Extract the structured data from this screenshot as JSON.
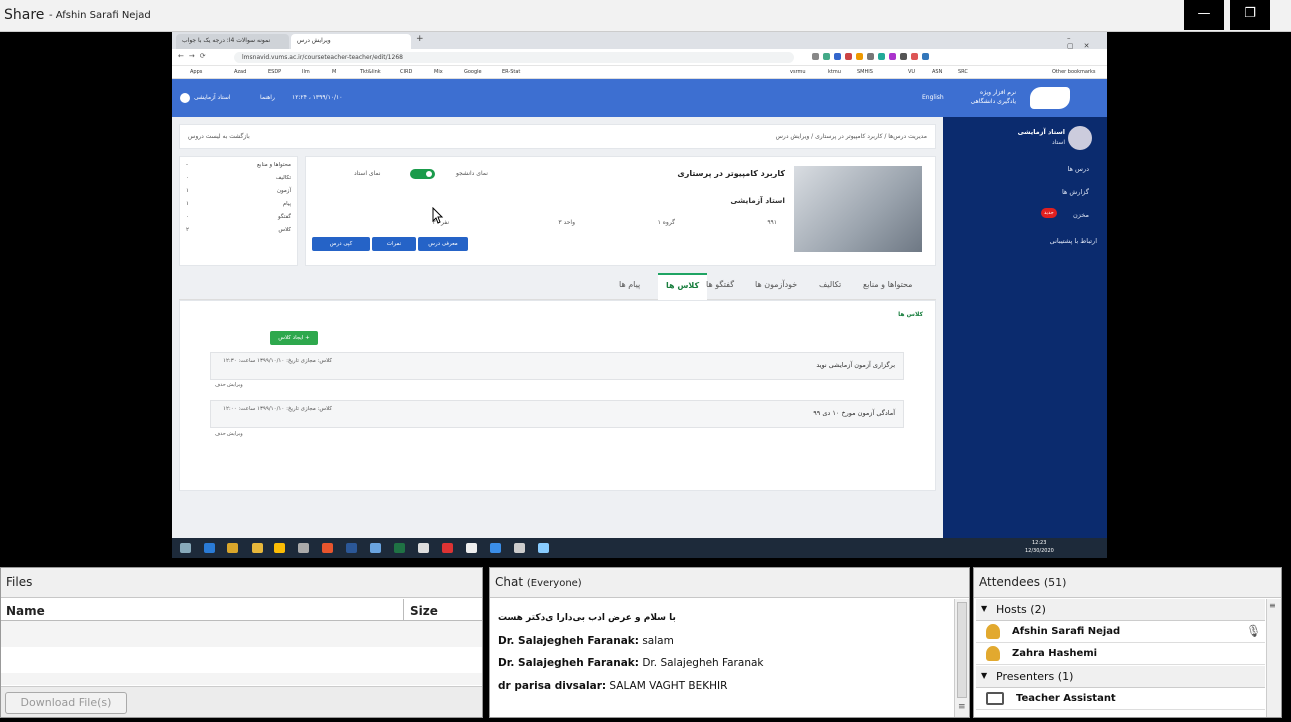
{
  "share": {
    "title": "Share",
    "presenter": "- Afshin Sarafi Nejad",
    "minimize": "—",
    "restore": "❐"
  },
  "browser": {
    "tabs": [
      "نمونه سوالات 4ا: درجه یک با جواب",
      "ویرایش درس"
    ],
    "new_tab": "+",
    "url": "lmsnavid.vums.ac.ir/courseteacher-teacher/edit/1268",
    "bookmarks": [
      "Apps",
      "Azad",
      "ESDP",
      "Ilm",
      "M",
      "Tkt&link",
      "CIRD",
      "Mix",
      "Google",
      "ER-Stat",
      "vsrmu",
      "ktmu",
      "SMHIS",
      "VU",
      "ASN",
      "SRC",
      "Other bookmarks"
    ]
  },
  "site": {
    "brand_line1": "نرم افزار ویژه",
    "brand_line2": "یادگیری دانشگاهی",
    "lang": "English",
    "datetime": "۱۲:۲۴ ، ۱۳۹۹/۱۰/۱۰",
    "help": "راهنما",
    "user": "استاد آزمایشی",
    "breadcrumb": "مدیریت درس‌ها / کاربرد کامپیوتر در پرستاری / ویرایش درس",
    "back": "بازگشت به لیست دروس",
    "course_title": "کاربرد کامپیوتر در پرستاری",
    "teacher": "استاد آزمایشی",
    "code": "۹۹۱",
    "group": "گروه ۱",
    "units": "واحد ۳",
    "students": "۳۰ نفر",
    "student_view": "نمای دانشجو",
    "teacher_view": "نمای استاد",
    "btn_intro": "معرفی درس",
    "btn_grades": "نمرات",
    "btn_copy": "کپی درس",
    "stats": [
      {
        "label": "محتواها و منابع",
        "value": "-"
      },
      {
        "label": "تکالیف",
        "value": "۰"
      },
      {
        "label": "آزمون",
        "value": "۱"
      },
      {
        "label": "پیام",
        "value": "۱"
      },
      {
        "label": "گفتگو",
        "value": "۰"
      },
      {
        "label": "کلاس",
        "value": "۲"
      }
    ],
    "tabs": [
      "محتواها و منابع",
      "تکالیف",
      "خودآزمون ها",
      "گفتگو ها",
      "کلاس ها",
      "پیام ها"
    ],
    "section_title": "کلاس ها",
    "create_btn": "ایجاد کلاس +",
    "classes": [
      {
        "title": "برگزاری آزمون آزمایشی نوید",
        "meta": "کلاس: مجازی   تاریخ: ۱۳۹۹/۱۰/۱۰   ساعت: ۱۲:۳۰",
        "edit": "ویرایش",
        "del": "حذف"
      },
      {
        "title": "آمادگی آزمون مورخ ۱۰ دی ۹۹",
        "meta": "کلاس: مجازی   تاریخ: ۱۳۹۹/۱۰/۱۰   ساعت: ۱۲:۰۰",
        "edit": "ویرایش",
        "del": "حذف"
      }
    ],
    "sidebar": {
      "user": "استاد آزمایشی",
      "role": "استاد",
      "items": [
        "درس ها",
        "گزارش ها",
        "مخزن",
        "ارتباط با پشتیبانی"
      ],
      "badge": "جدید"
    },
    "clock_time": "12:23",
    "clock_date": "12/30/2020"
  },
  "files": {
    "title": "Files",
    "col_name": "Name",
    "col_size": "Size",
    "download": "Download File(s)"
  },
  "chat": {
    "title": "Chat",
    "scope": "(Everyone)",
    "messages": [
      {
        "sender": "",
        "text": "با سلام و عرض ادب بی‌دارا ی‌دکتر هست"
      },
      {
        "sender": "Dr. Salajegheh Faranak:",
        "text": " salam"
      },
      {
        "sender": "Dr. Salajegheh Faranak:",
        "text": " Dr. Salajegheh Faranak"
      },
      {
        "sender": "dr parisa divsalar:",
        "text": " SALAM VAGHT BEKHIR"
      }
    ]
  },
  "attendees": {
    "title": "Attendees",
    "count": "(51)",
    "hosts_label": "Hosts (2)",
    "hosts": [
      "Afshin Sarafi Nejad",
      "Zahra Hashemi"
    ],
    "presenters_label": "Presenters (1)",
    "presenters": [
      "Teacher Assistant"
    ]
  }
}
